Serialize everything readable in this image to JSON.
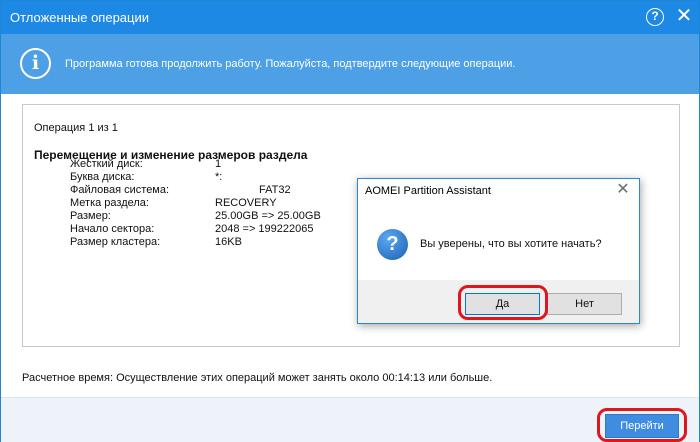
{
  "window": {
    "title": "Отложенные операции",
    "help_glyph": "?",
    "close_glyph": "✕"
  },
  "info_bar": {
    "icon_glyph": "i",
    "text": "Программа готова продолжить работу. Пожалуйста, подтвердите следующие операции."
  },
  "operation": {
    "counter": "Операция 1 из 1",
    "title": "Перемещение и изменение размеров раздела",
    "details": [
      {
        "label": "Жесткий диск:",
        "value": "1"
      },
      {
        "label": "Буква диска:",
        "value": "*:"
      },
      {
        "label": "Файловая система:",
        "value": "FAT32"
      },
      {
        "label": "Метка раздела:",
        "value": "RECOVERY"
      },
      {
        "label": "Размер:",
        "value": "25.00GB => 25.00GB"
      },
      {
        "label": "Начало сектора:",
        "value": "2048 => 199222065"
      },
      {
        "label": "Размер кластера:",
        "value": "16KB"
      }
    ]
  },
  "estimate": {
    "text": "Расчетное время: Осуществление этих операций может занять около 00:14:13 или больше."
  },
  "footer": {
    "go_label": "Перейти"
  },
  "dialog": {
    "title": "AOMEI Partition Assistant",
    "close_glyph": "✕",
    "icon_glyph": "?",
    "message": "Вы уверены, что вы хотите начать?",
    "yes_label": "Да",
    "no_label": "Нет"
  },
  "colors": {
    "titlebar": "#1e88e5",
    "info_bar": "#4d9fe6",
    "primary_button": "#3e8de0",
    "highlight": "#e0161d"
  }
}
